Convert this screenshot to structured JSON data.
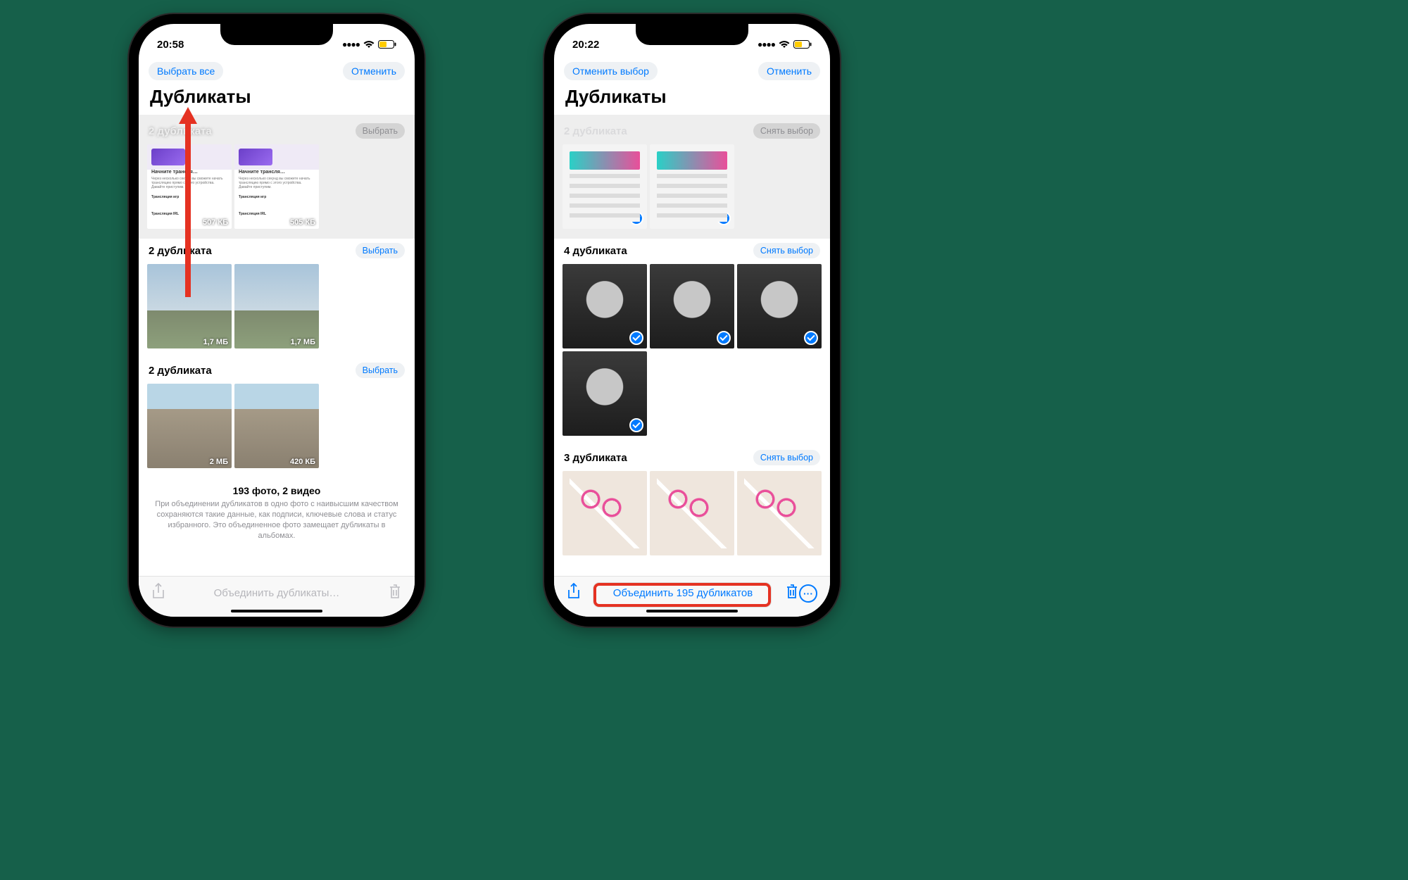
{
  "phone_left": {
    "status": {
      "time": "20:58"
    },
    "topbar": {
      "select_all": "Выбрать все",
      "cancel": "Отменить"
    },
    "title": "Дубликаты",
    "groups": [
      {
        "title": "2 дубликата",
        "action": "Выбрать",
        "thumbs": [
          {
            "headline": "Начните трансля…",
            "sub1": "Через несколько секунд вы сможете начать трансляцию прямо с этого устройства. Давайте приступим.",
            "row2": "Трансляция игр",
            "row3": "Трансляция IRL",
            "size": "507 КБ"
          },
          {
            "headline": "Начните трансля…",
            "sub1": "Через несколько секунд вы сможете начать трансляцию прямо с этого устройства. Давайте приступим.",
            "row2": "Трансляция игр",
            "row3": "Трансляция IRL",
            "size": "505 КБ"
          }
        ]
      },
      {
        "title": "2 дубликата",
        "action": "Выбрать",
        "thumbs": [
          {
            "size": "1,7 МБ"
          },
          {
            "size": "1,7 МБ"
          }
        ]
      },
      {
        "title": "2 дубликата",
        "action": "Выбрать",
        "thumbs": [
          {
            "size": "2 МБ"
          },
          {
            "size": "420 КБ"
          }
        ]
      }
    ],
    "footer": {
      "title": "193 фото, 2 видео",
      "desc": "При объединении дубликатов в одно фото с наивысшим качеством сохраняются такие данные, как подписи, ключевые слова и статус избранного. Это объединенное фото замещает дубликаты в альбомах."
    },
    "toolbar": {
      "merge": "Объединить дубликаты…"
    }
  },
  "phone_right": {
    "status": {
      "time": "20:22"
    },
    "topbar": {
      "deselect": "Отменить выбор",
      "cancel": "Отменить"
    },
    "title": "Дубликаты",
    "groups": [
      {
        "title": "2 дубликата",
        "action": "Снять выбор"
      },
      {
        "title": "4 дубликата",
        "action": "Снять выбор"
      },
      {
        "title": "3 дубликата",
        "action": "Снять выбор"
      }
    ],
    "toolbar": {
      "merge": "Объединить 195 дубликатов"
    }
  }
}
